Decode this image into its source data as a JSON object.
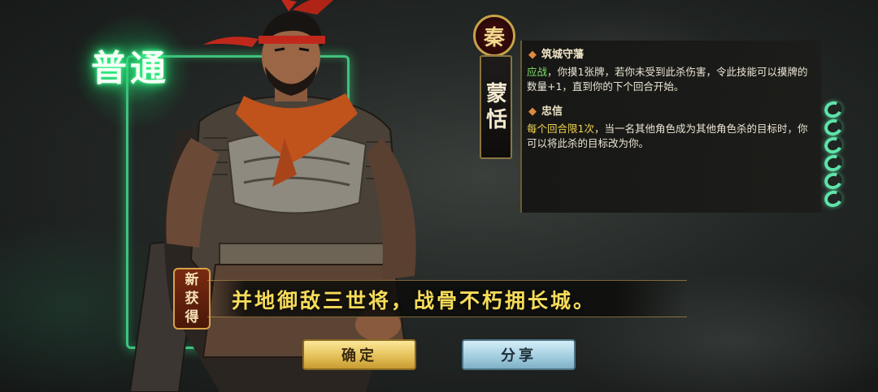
{
  "rarity": "普通",
  "hero": {
    "faction": "秦",
    "name_chars": [
      "蒙",
      "恬"
    ]
  },
  "skills": [
    {
      "name": "筑城守藩",
      "keyword": "应战",
      "desc": "，你摸1张牌，若你未受到此杀伤害，令此技能可以摸牌的数量+1，直到你的下个回合开始。"
    },
    {
      "name": "忠信",
      "keyword": "每个回合限1次",
      "desc": "，当一名其他角色成为其他角色杀的目标时，你可以将此杀的目标改为你。"
    }
  ],
  "health": {
    "current": 6,
    "max": 6
  },
  "new_badge": [
    "新",
    "获",
    "得"
  ],
  "quote": "并地御敌三世将，战骨不朽拥长城。",
  "buttons": {
    "confirm_label": "确定",
    "share_label": "分享"
  },
  "colors": {
    "rarity_glow": "#2cff86",
    "card_border": "#3fc27e",
    "quote": "#f6dc5a",
    "keyword_green": "#7ee06a",
    "keyword_yellow": "#f2d54e",
    "confirm_button": "#e5c25a",
    "share_button": "#a4cfe0"
  }
}
